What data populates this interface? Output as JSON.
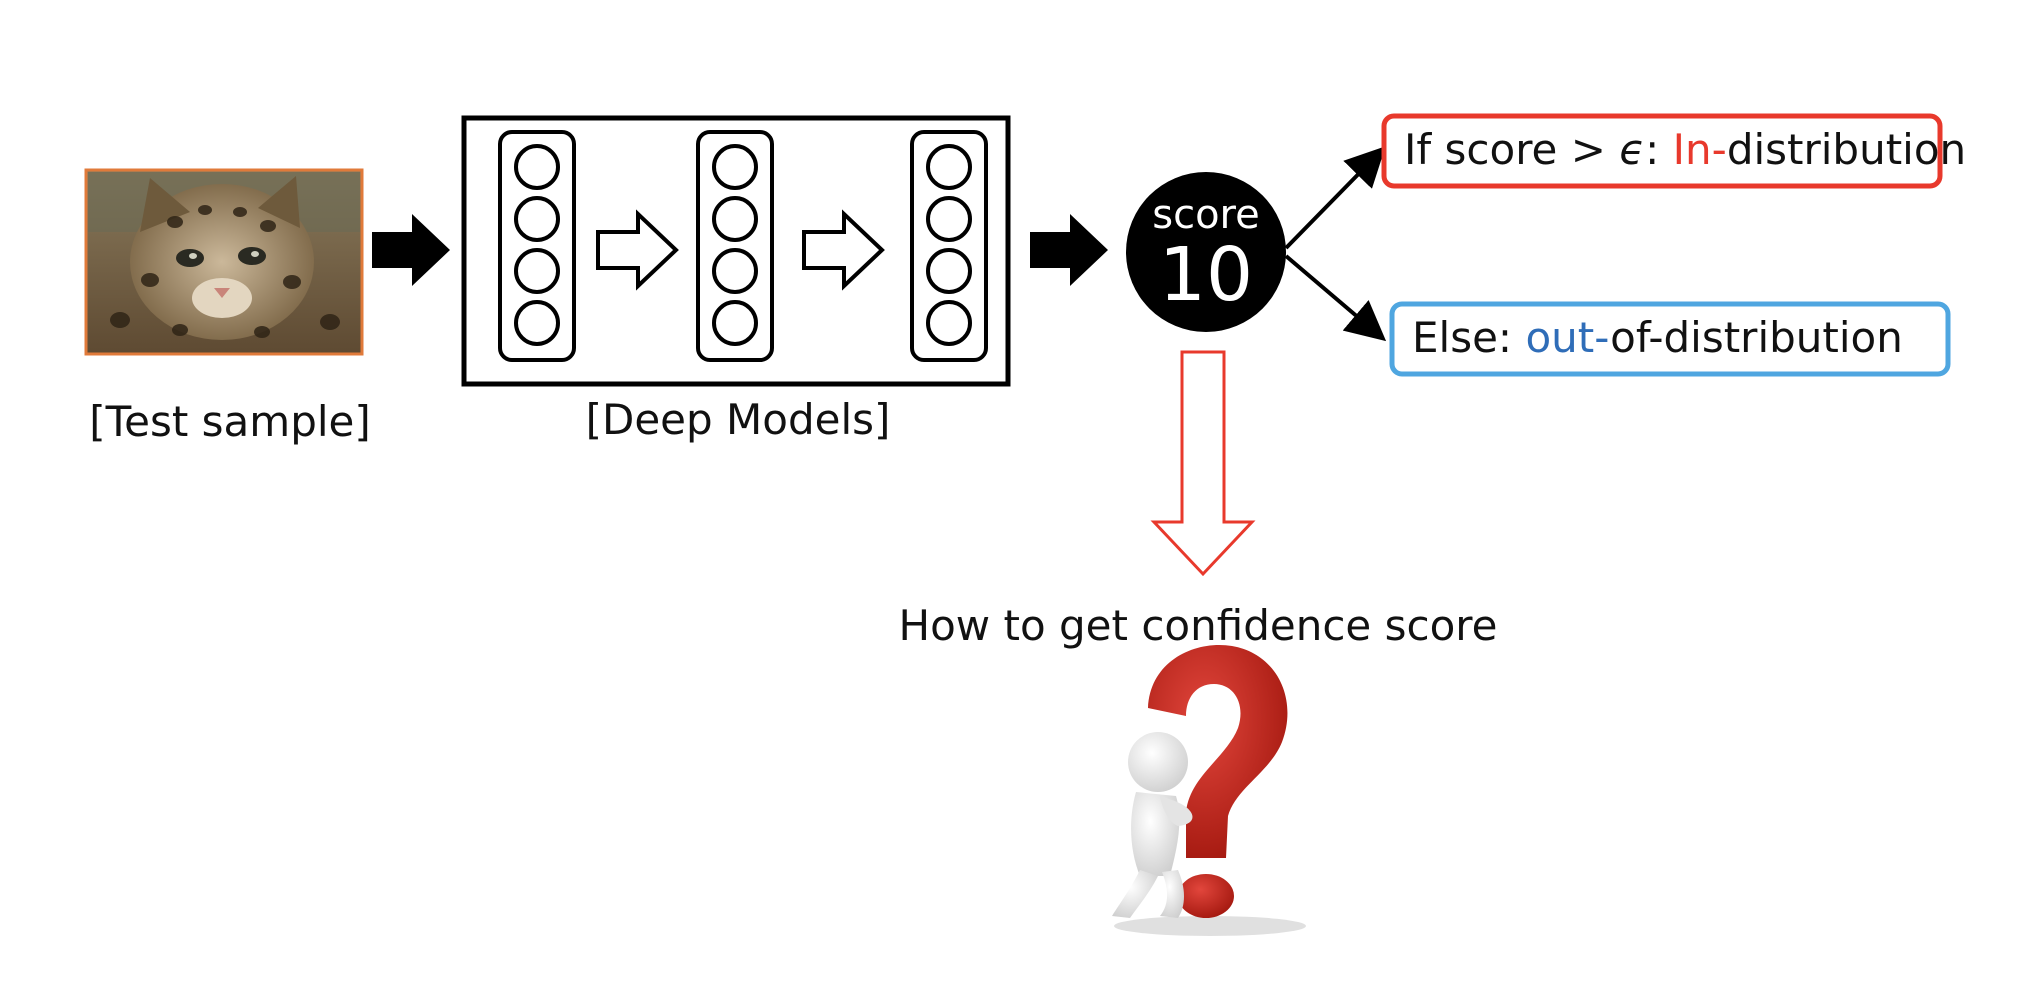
{
  "test_sample": {
    "label": "[Test sample]",
    "image_subject": "wild-cat-kitten"
  },
  "deep_model": {
    "label": "[Deep Models]",
    "layer_count": 3,
    "nodes_per_layer": 4
  },
  "score": {
    "word": "score",
    "value": "10"
  },
  "outcomes": {
    "in_dist": {
      "prefix": "If score > ",
      "epsilon": "ϵ",
      "colon": ": ",
      "highlight": "In-",
      "suffix": "distribution",
      "border_color": "#e8392c",
      "highlight_color": "#e8392c"
    },
    "out_dist": {
      "prefix": "Else: ",
      "highlight": "out-",
      "suffix": "of-distribution",
      "border_color": "#4fa6e0",
      "highlight_color": "#2f6db8"
    }
  },
  "question": {
    "caption": "How to get confidence score",
    "arrow_color": "#e8392c",
    "mark_color": "#c8221a"
  }
}
